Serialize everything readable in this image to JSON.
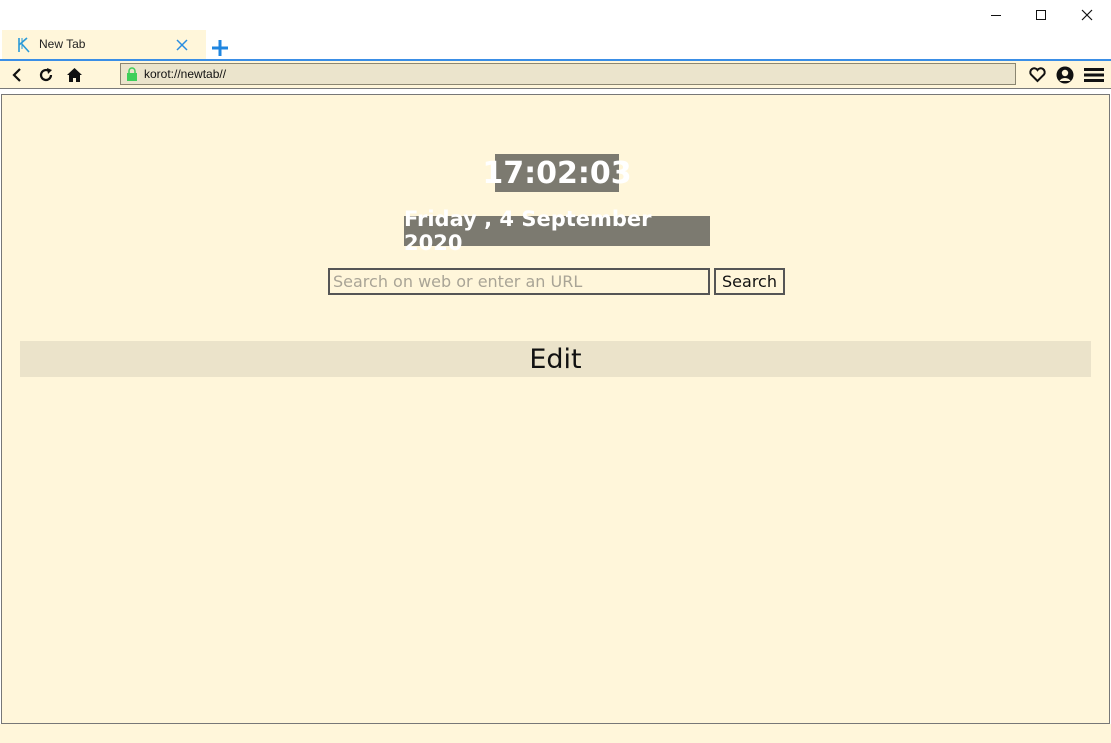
{
  "window": {
    "controls": {
      "minimize_icon": "minimize-icon",
      "maximize_icon": "maximize-icon",
      "close_icon": "close-icon"
    }
  },
  "tabs": [
    {
      "title": "New Tab",
      "active": true,
      "favicon": "korot-logo-icon"
    }
  ],
  "toolbar": {
    "url": "korot://newtab//",
    "secure": true
  },
  "page": {
    "clock": "17:02:03",
    "date": "Friday , 4 September 2020",
    "search": {
      "placeholder": "Search on web or enter an URL",
      "value": "",
      "button_label": "Search"
    },
    "edit_label": "Edit"
  },
  "colors": {
    "page_background": "#fff6da",
    "accent": "#3a8ee6",
    "badge_background": "#7c7a70",
    "edit_bar": "#ebe3ca",
    "lock": "#3ecf5a"
  }
}
